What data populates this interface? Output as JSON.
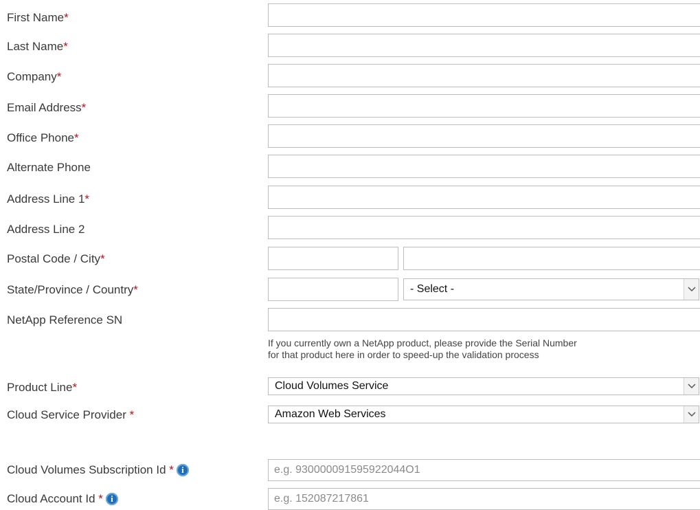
{
  "fields": {
    "first_name": {
      "label": "First Name",
      "required": "*",
      "value": ""
    },
    "last_name": {
      "label": "Last Name",
      "required": "*",
      "value": ""
    },
    "company": {
      "label": "Company",
      "required": "*",
      "value": ""
    },
    "email": {
      "label": "Email Address",
      "required": "*",
      "value": ""
    },
    "office_phone": {
      "label": "Office Phone",
      "required": "*",
      "value": ""
    },
    "alternate_phone": {
      "label": "Alternate Phone",
      "value": ""
    },
    "address1": {
      "label": "Address Line 1",
      "required": "*",
      "value": ""
    },
    "address2": {
      "label": "Address Line 2",
      "value": ""
    },
    "postal_city": {
      "label": "Postal Code / City",
      "required": "*",
      "postal_value": "",
      "city_value": ""
    },
    "state_country": {
      "label": "State/Province / Country",
      "required": "*",
      "state_value": "",
      "country_selected": "- Select -"
    },
    "netapp_sn": {
      "label": "NetApp Reference SN",
      "value": "",
      "help_line1": "If you currently own a NetApp product, please provide the Serial Number",
      "help_line2": "for that product here in order to speed-up the validation process"
    },
    "product_line": {
      "label": "Product Line",
      "required": "*",
      "selected": "Cloud Volumes Service"
    },
    "cloud_provider": {
      "label": "Cloud Service Provider ",
      "required": "*",
      "selected": "Amazon Web Services"
    },
    "subscription_id": {
      "label": "Cloud Volumes Subscription Id ",
      "required": "*",
      "placeholder": "e.g. 930000091595922044O1"
    },
    "account_id": {
      "label": "Cloud Account Id ",
      "required": "*",
      "placeholder": "e.g. 152087217861"
    }
  },
  "icons": {
    "info": "i",
    "info_name": "info-icon",
    "chevron": "chevron-down-icon"
  },
  "colors": {
    "required": "#b5121b",
    "info": "#1f6fb8",
    "border": "#bdbdbd"
  }
}
